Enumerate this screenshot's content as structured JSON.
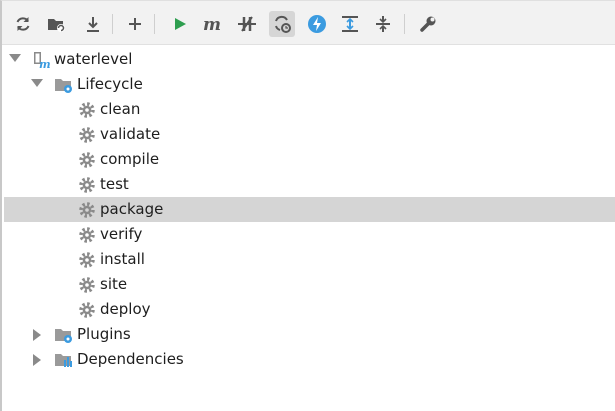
{
  "toolbar": {
    "icons": [
      "refresh-icon",
      "generate-sources-icon",
      "download-icon",
      "add-icon",
      "run-icon",
      "maven-goal-icon",
      "skip-tests-icon",
      "offline-mode-icon",
      "lightning-icon",
      "expand-all-icon",
      "collapse-all-icon",
      "settings-wrench-icon"
    ],
    "active": "offline-mode-icon"
  },
  "tree": {
    "project": "waterlevel",
    "lifecycle": {
      "label": "Lifecycle",
      "items": [
        "clean",
        "validate",
        "compile",
        "test",
        "package",
        "verify",
        "install",
        "site",
        "deploy"
      ],
      "selected": "package"
    },
    "plugins": "Plugins",
    "dependencies": "Dependencies"
  },
  "colors": {
    "run": "#2e9e4f",
    "lightning": "#3b9be0",
    "selection": "#d5d5d5",
    "icon_gray": "#555555"
  }
}
